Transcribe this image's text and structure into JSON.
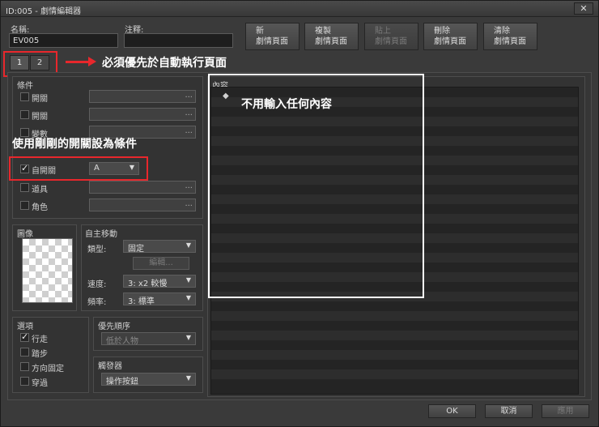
{
  "window": {
    "title": "ID:005 - 劇情編輯器",
    "close_glyph": "✕"
  },
  "name_field": {
    "label": "名稱:",
    "value": "EV005"
  },
  "note_field": {
    "label": "注釋:",
    "value": ""
  },
  "toolbar": [
    {
      "line1": "新",
      "line2": "劇情頁面",
      "enabled": true
    },
    {
      "line1": "複製",
      "line2": "劇情頁面",
      "enabled": true
    },
    {
      "line1": "貼上",
      "line2": "劇情頁面",
      "enabled": false
    },
    {
      "line1": "刪除",
      "line2": "劇情頁面",
      "enabled": true
    },
    {
      "line1": "清除",
      "line2": "劇情頁面",
      "enabled": true
    }
  ],
  "page_tabs": [
    "1",
    "2"
  ],
  "conditions": {
    "title": "條件",
    "items": [
      {
        "label": "開關",
        "checked": false,
        "value": ""
      },
      {
        "label": "開關",
        "checked": false,
        "value": ""
      },
      {
        "label": "變數",
        "checked": false,
        "value": ""
      },
      {
        "label": "自開關",
        "checked": true,
        "value": "A"
      },
      {
        "label": "道具",
        "checked": false,
        "value": ""
      },
      {
        "label": "角色",
        "checked": false,
        "value": ""
      }
    ],
    "ellipsis": "..."
  },
  "image": {
    "title": "圖像"
  },
  "autonomous": {
    "title": "自主移動",
    "type_label": "類型:",
    "type_value": "固定",
    "edit_label": "編輯...",
    "speed_label": "速度:",
    "speed_value": "3: x2 較慢",
    "freq_label": "頻率:",
    "freq_value": "3: 標準"
  },
  "options": {
    "title": "選項",
    "items": [
      {
        "label": "行走",
        "checked": true
      },
      {
        "label": "踏步",
        "checked": false
      },
      {
        "label": "方向固定",
        "checked": false
      },
      {
        "label": "穿過",
        "checked": false
      }
    ]
  },
  "priority": {
    "title": "優先順序",
    "value": "低於人物"
  },
  "trigger": {
    "title": "觸發器",
    "value": "操作按鈕"
  },
  "contents": {
    "title": "內容",
    "bullet": "◆"
  },
  "footer": {
    "ok": "OK",
    "cancel": "取消",
    "apply": "應用"
  },
  "annotations": {
    "tab_note": "必須優先於自動執行頁面",
    "condition_note": "使用剛剛的開關設為條件",
    "contents_note": "不用輸入任何內容"
  },
  "colors": {
    "annotation_red": "#e8272c",
    "annotation_white_box": "#ffffff"
  }
}
